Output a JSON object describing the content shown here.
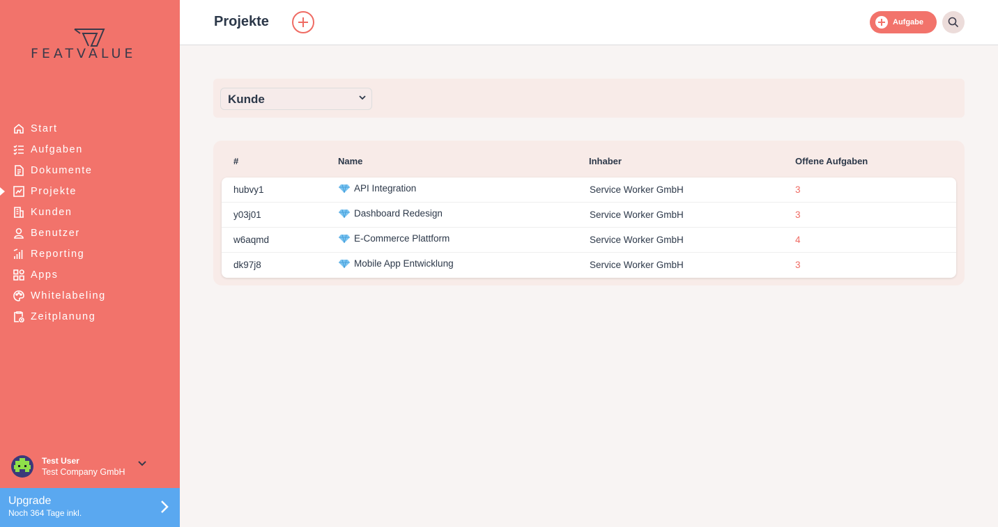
{
  "brand": {
    "logo_text": "FEATVALUE"
  },
  "sidebar": {
    "items": [
      {
        "label": "Start",
        "icon": "home-icon"
      },
      {
        "label": "Aufgaben",
        "icon": "task-list-icon"
      },
      {
        "label": "Dokumente",
        "icon": "document-icon"
      },
      {
        "label": "Projekte",
        "icon": "chart-icon",
        "active": true
      },
      {
        "label": "Kunden",
        "icon": "building-icon"
      },
      {
        "label": "Benutzer",
        "icon": "user-icon"
      },
      {
        "label": "Reporting",
        "icon": "bar-chart-icon"
      },
      {
        "label": "Apps",
        "icon": "apps-icon"
      },
      {
        "label": "Whitelabeling",
        "icon": "palette-icon"
      },
      {
        "label": "Zeitplanung",
        "icon": "clipboard-clock-icon"
      }
    ]
  },
  "user": {
    "name": "Test User",
    "company": "Test Company GmbH"
  },
  "upgrade": {
    "title": "Upgrade",
    "subtitle": "Noch 364 Tage inkl."
  },
  "header": {
    "title": "Projekte",
    "task_button": "Aufgabe"
  },
  "filter": {
    "selected": "Kunde"
  },
  "table": {
    "headers": [
      "#",
      "Name",
      "Inhaber",
      "Offene Aufgaben"
    ],
    "rows": [
      {
        "id": "hubvy1",
        "name": "API Integration",
        "owner": "Service Worker GmbH",
        "open": "3"
      },
      {
        "id": "y03j01",
        "name": "Dashboard Redesign",
        "owner": "Service Worker GmbH",
        "open": "3"
      },
      {
        "id": "w6aqmd",
        "name": "E-Commerce Plattform",
        "owner": "Service Worker GmbH",
        "open": "4"
      },
      {
        "id": "dk97j8",
        "name": "Mobile App Entwicklung",
        "owner": "Service Worker GmbH",
        "open": "3"
      }
    ]
  },
  "colors": {
    "accent": "#f2736b",
    "upgrade": "#5aa8f0",
    "text": "#2c3849"
  }
}
